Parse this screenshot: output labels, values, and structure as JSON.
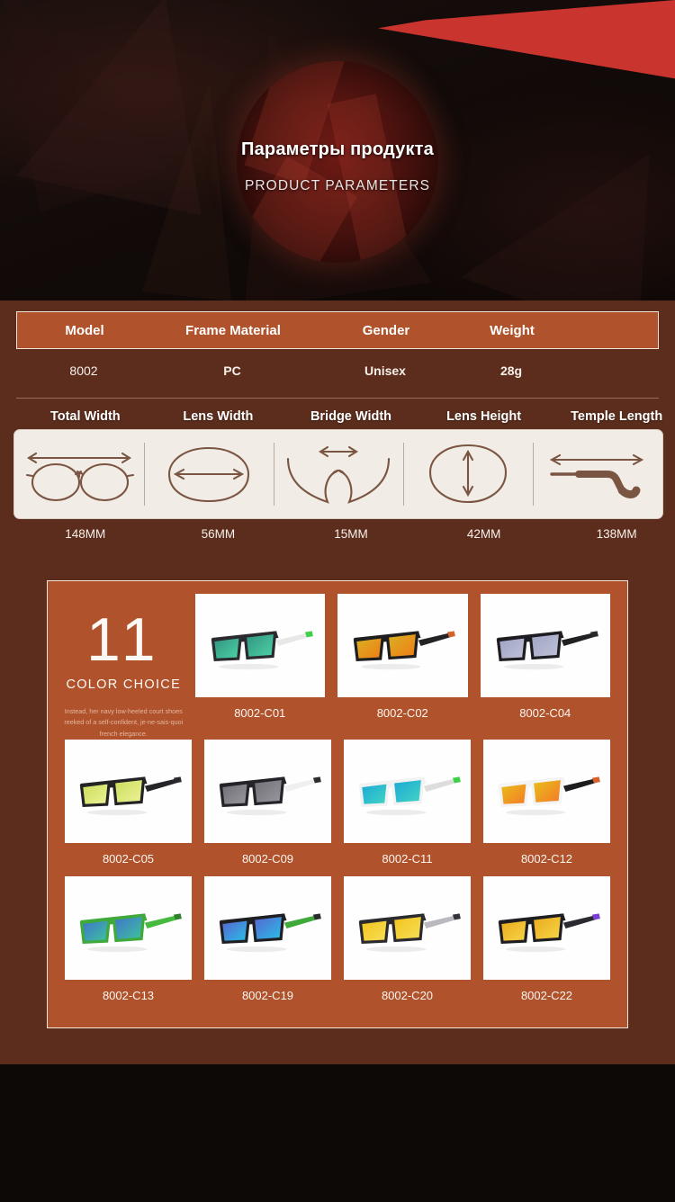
{
  "hero": {
    "title": "Параметры продукта",
    "subtitle": "PRODUCT PARAMETERS",
    "accent_color": "#c9342e",
    "background_color": "#120b09"
  },
  "spec_table": {
    "headers": [
      "Model",
      "Frame Material",
      "Gender",
      "Weight"
    ],
    "values": [
      "8002",
      "PC",
      "Unisex",
      "28g"
    ],
    "header_bg": "#b0522b",
    "band_bg": "#5c2d1c"
  },
  "dimensions": {
    "headers": [
      "Total Width",
      "Lens Width",
      "Bridge Width",
      "Lens Height",
      "Temple Length"
    ],
    "values": [
      "148MM",
      "56MM",
      "15MM",
      "42MM",
      "138MM"
    ],
    "icons": [
      "total-width-icon",
      "lens-width-icon",
      "bridge-width-icon",
      "lens-height-icon",
      "temple-length-icon"
    ],
    "box_bg": "#f2ece6",
    "line_color": "#7a5542"
  },
  "color_choice": {
    "count": "11",
    "label": "COLOR CHOICE",
    "description": "Instead, her navy low-heeled court shoes reeked of a self-confident, je-ne-sais-quoi french elegance.",
    "panel_bg": "#b0522b",
    "items": [
      {
        "label": "8002-C01",
        "frame": "#2b2b2f",
        "temple": "#e8e8e8",
        "tip": "#3fd04a",
        "lens_a": "#2f8f7e",
        "lens_b": "#4fd6a8"
      },
      {
        "label": "8002-C02",
        "frame": "#1e1e20",
        "temple": "#232325",
        "tip": "#d4622a",
        "lens_a": "#d9b324",
        "lens_b": "#f07a14"
      },
      {
        "label": "8002-C04",
        "frame": "#1d1d21",
        "temple": "#212124",
        "tip": "#2a2a2d",
        "lens_a": "#9ea2c4",
        "lens_b": "#c0c3d8"
      },
      {
        "label": "8002-C05",
        "frame": "#232326",
        "temple": "#26262a",
        "tip": "#2a2a2e",
        "lens_a": "#c9dc57",
        "lens_b": "#eef39a"
      },
      {
        "label": "8002-C09",
        "frame": "#242428",
        "temple": "#efefef",
        "tip": "#2c2c30",
        "lens_a": "#6d6d73",
        "lens_b": "#9a9aa0"
      },
      {
        "label": "8002-C11",
        "frame": "#f2f2f2",
        "temple": "#dddddd",
        "tip": "#3fd04a",
        "lens_a": "#18a7d6",
        "lens_b": "#45d6c3"
      },
      {
        "label": "8002-C12",
        "frame": "#f4f4f4",
        "temple": "#1d1d20",
        "tip": "#d4622a",
        "lens_a": "#e8c318",
        "lens_b": "#f4762a"
      },
      {
        "label": "8002-C13",
        "frame": "#3fa93a",
        "temple": "#46b93f",
        "tip": "#2f7f2c",
        "lens_a": "#3f6fcf",
        "lens_b": "#3fc79a"
      },
      {
        "label": "8002-C19",
        "frame": "#1f1f23",
        "temple": "#3fa93a",
        "tip": "#2b2b2f",
        "lens_a": "#5a5fd0",
        "lens_b": "#27c4e8"
      },
      {
        "label": "8002-C20",
        "frame": "#2a2a2f",
        "temple": "#b9b9bf",
        "tip": "#33333a",
        "lens_a": "#f0c21a",
        "lens_b": "#f9e05a"
      },
      {
        "label": "8002-C22",
        "frame": "#1e1e22",
        "temple": "#2a2a30",
        "tip": "#7a3fd0",
        "lens_a": "#e8a81a",
        "lens_b": "#f7d84a"
      }
    ]
  }
}
